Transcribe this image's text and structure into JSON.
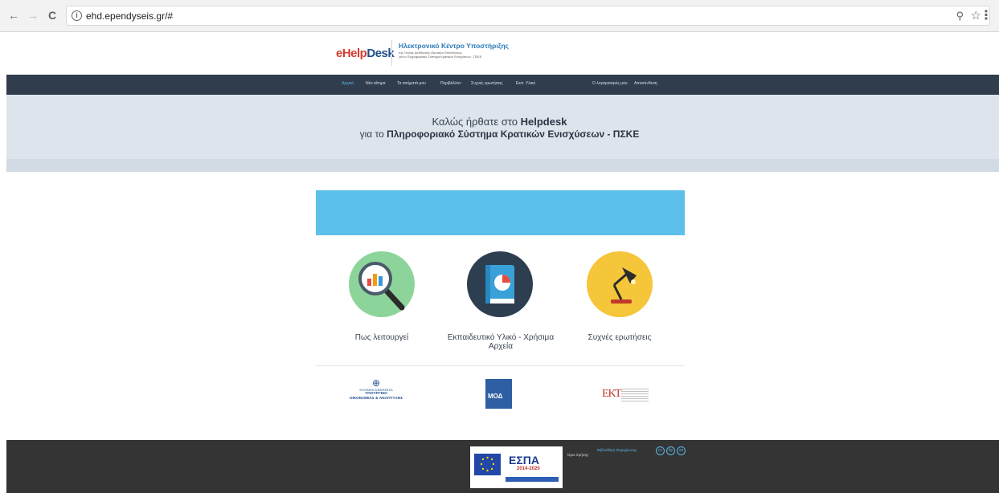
{
  "browser": {
    "url": "ehd.ependyseis.gr/#",
    "back_icon": "←",
    "forward_icon": "→",
    "reload_icon": "C",
    "info_icon": "i",
    "zoom_icon": "⚲",
    "star_icon": "☆",
    "menu_icon": "⋮"
  },
  "header": {
    "logo": {
      "e": "e",
      "help": "Help",
      "desk": "Desk"
    },
    "title": "Ηλεκτρονικό Κέντρο Υποστήριξης",
    "subtitle_line1": "της Γενικής Διεύθυνσης Ιδιωτικών Επενδύσεων",
    "subtitle_line2": "για το Πληροφοριακό Σύστημα Κρατικών Ενισχύσεων - ΠΣΚΕ"
  },
  "nav": {
    "items": [
      "Αρχική",
      "Νέο αίτημα",
      "Τα αιτήματά μου",
      "Περιβάλλον",
      "Συχνές ερωτήσεις",
      "Εκπ. Υλικό"
    ],
    "account": "Ο λογαριασμός μου",
    "logout": "Αποσύνδεση"
  },
  "hero": {
    "line1_prefix": "Καλώς ήρθατε στο ",
    "line1_bold": "Helpdesk",
    "line2_prefix": "για το ",
    "line2_bold": "Πληροφοριακό Σύστημα Κρατικών Ενισχύσεων - ΠΣΚΕ"
  },
  "info_box": {
    "text": "",
    "bullet": ""
  },
  "cards": [
    {
      "label": "Πως λειτουργεί"
    },
    {
      "label": "Εκπαιδευτικό Υλικό - Χρήσιμα Αρχεία"
    },
    {
      "label": "Συχνές ερωτήσεις"
    }
  ],
  "partners": {
    "ministry_line1": "ΕΛΛΗΝΙΚΗ ΔΗΜΟΚΡΑΤΙΑ",
    "ministry_line2": "ΥΠΟΥΡΓΕΙΟ",
    "ministry_line3": "ΟΙΚΟΝΟΜΙΑΣ & ΑΝΑΠΤΥΞΗΣ",
    "moda": "ΜΟΔ",
    "ekt": "ΕΚΤ"
  },
  "footer": {
    "text": "",
    "espa_word": "ΕΣΠΑ",
    "espa_years": "2014-2020",
    "terms": "Όροι Χρήσης",
    "library": "Βιβλιοθήκη Τεκμηρίωσης",
    "cc_icons": [
      "cc",
      "by",
      "sa"
    ]
  },
  "colors": {
    "nav_bg": "#2f3d4d",
    "nav_active": "#5bb6e8",
    "hero_bg": "#dde4ec",
    "info_bg": "#5cc0ea",
    "footer_bg": "#343434",
    "circle_green": "#8cd49a",
    "circle_navy": "#2c3e50",
    "circle_yellow": "#f6c63a"
  }
}
